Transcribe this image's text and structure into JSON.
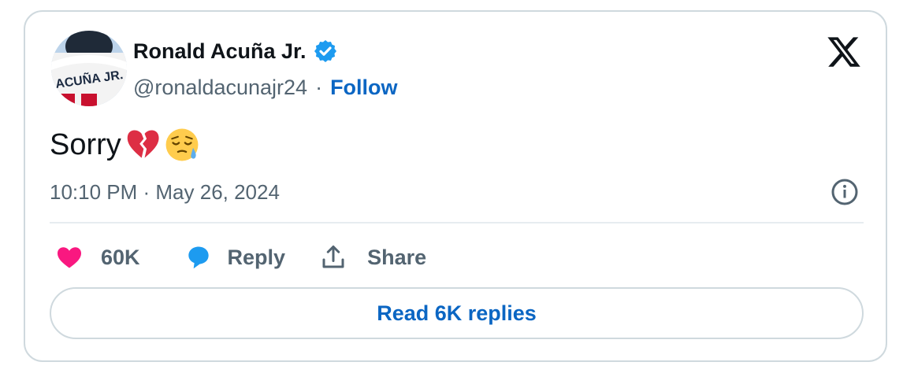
{
  "author": {
    "name": "Ronald Acuña Jr.",
    "handle": "@ronaldacunajr24",
    "separator": "·",
    "follow_label": "Follow",
    "avatar_jersey_text": "ACUÑA JR."
  },
  "tweet": {
    "text": "Sorry",
    "emojis": [
      "broken-heart-icon",
      "sleepy-face-icon"
    ],
    "timestamp": "10:10 PM · May 26, 2024"
  },
  "actions": {
    "likes_count": "60K",
    "reply_label": "Reply",
    "share_label": "Share"
  },
  "read_replies_label": "Read 6K replies",
  "colors": {
    "like": "#f91880",
    "reply_bubble": "#1d9bf0",
    "link": "#0b66c3",
    "muted": "#536471",
    "verified": "#1d9bf0"
  },
  "icons": [
    "verified-badge-icon",
    "x-logo-icon",
    "info-icon",
    "heart-icon",
    "reply-bubble-icon",
    "share-icon"
  ]
}
